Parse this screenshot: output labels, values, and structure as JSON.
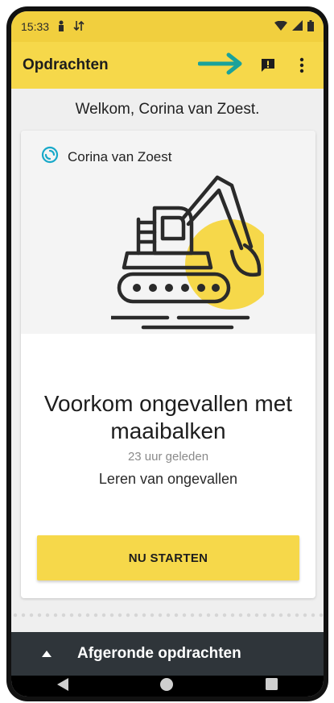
{
  "status_bar": {
    "time": "15:33"
  },
  "app_bar": {
    "title": "Opdrachten"
  },
  "welcome": {
    "text": "Welkom, Corina  van Zoest."
  },
  "card": {
    "author": "Corina  van Zoest",
    "title": "Voorkom ongevallen met maaibalken",
    "time_ago": "23 uur geleden",
    "category": "Leren van ongevallen",
    "start_label": "NU STARTEN"
  },
  "bottom_sheet": {
    "label": "Afgeronde opdrachten"
  },
  "colors": {
    "accent": "#f6d84a",
    "annotation_arrow": "#1aa29b",
    "sheet": "#2f353a"
  },
  "icons": [
    "person-icon",
    "data-sync-icon",
    "wifi-icon",
    "signal-icon",
    "battery-icon",
    "arrow-annotation-icon",
    "feedback-icon",
    "more-vert-icon",
    "brand-logo-icon",
    "excavator-illustration",
    "chevron-up-icon",
    "nav-back-icon",
    "nav-home-icon",
    "nav-recents-icon"
  ]
}
